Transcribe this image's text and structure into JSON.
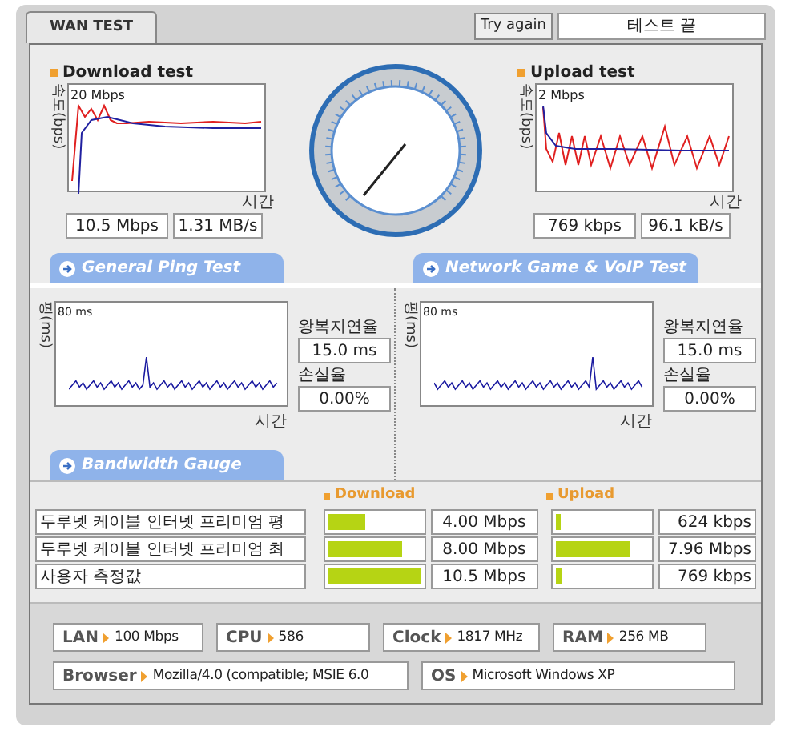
{
  "tab": {
    "label": "WAN TEST",
    "selected": true
  },
  "try_again": "Try again",
  "status": "테스트 끝",
  "speed_tests": [
    {
      "title": "Download test",
      "axis_label": "속도(bps)",
      "scale": "20 Mbps",
      "time_label": "시간",
      "rate": "10.5 Mbps",
      "bytes": "1.31 MB/s"
    },
    {
      "title": "Upload test",
      "axis_label": "속도(bps)",
      "scale": "2 Mbps",
      "time_label": "시간",
      "rate": "769 kbps",
      "bytes": "96.1 kB/s"
    }
  ],
  "ping_tests": [
    {
      "tab": "General Ping Test",
      "axis_label": "핑(ms)",
      "scale": "80 ms",
      "time_label": "시간",
      "latency_label": "왕복지연율",
      "latency": "15.0 ms",
      "loss_label": "손실율",
      "loss": "0.00%"
    },
    {
      "tab": "Network Game & VoIP Test",
      "axis_label": "핑(ms)",
      "scale": "80 ms",
      "time_label": "시간",
      "latency_label": "왕복지연율",
      "latency": "15.0 ms",
      "loss_label": "손실율",
      "loss": "0.00%"
    }
  ],
  "bandwidth": {
    "tab": "Bandwidth Gauge",
    "download_header": "Download",
    "upload_header": "Upload",
    "rows": [
      {
        "name": "두루넷 케이블 인터넷 프리미엄 평",
        "download": {
          "level": 0.4,
          "value": "4.00 Mbps"
        },
        "upload": {
          "level": 0.06,
          "value": "624 kbps"
        }
      },
      {
        "name": "두루넷 케이블 인터넷 프리미엄 최",
        "download": {
          "level": 0.8,
          "value": "8.00 Mbps"
        },
        "upload": {
          "level": 0.8,
          "value": "7.96 Mbps"
        }
      },
      {
        "name": "사용자 측정값",
        "download": {
          "level": 1,
          "value": "10.5 Mbps"
        },
        "upload": {
          "level": 0.07,
          "value": "769 kbps"
        }
      }
    ]
  },
  "system_info": [
    [
      {
        "label": "LAN",
        "value": "100 Mbps"
      },
      {
        "label": "CPU",
        "value": "586"
      },
      {
        "label": "Clock",
        "value": "1817 MHz"
      },
      {
        "label": "RAM",
        "value": "256 MB"
      }
    ],
    [
      {
        "label": "Browser",
        "value": "Mozilla/4.0 (compatible; MSIE 6.0"
      },
      {
        "label": "OS",
        "value": "Microsoft Windows XP"
      }
    ]
  ]
}
